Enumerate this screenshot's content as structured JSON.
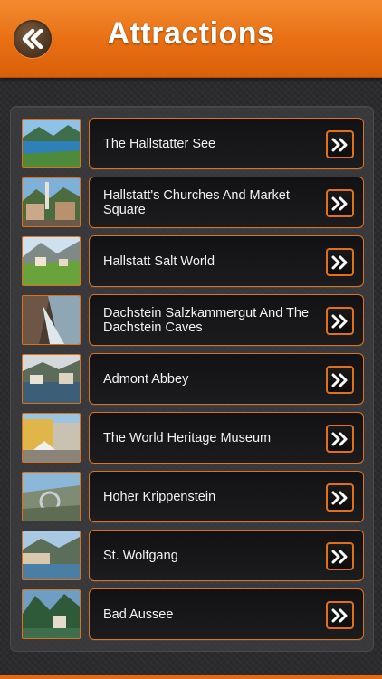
{
  "header": {
    "title": "Attractions",
    "back_icon": "double-chevron-left-icon"
  },
  "colors": {
    "accent": "#e96e12",
    "background": "#2b2b2d",
    "item_border": "#d9731f"
  },
  "items": [
    {
      "label": "The Hallstatter See"
    },
    {
      "label": "Hallstatt's Churches And Market Square"
    },
    {
      "label": "Hallstatt Salt World"
    },
    {
      "label": "Dachstein Salzkammergut And The Dachstein Caves"
    },
    {
      "label": "Admont Abbey"
    },
    {
      "label": "The World Heritage Museum"
    },
    {
      "label": "Hoher Krippenstein"
    },
    {
      "label": "St. Wolfgang"
    },
    {
      "label": "Bad Aussee"
    }
  ]
}
